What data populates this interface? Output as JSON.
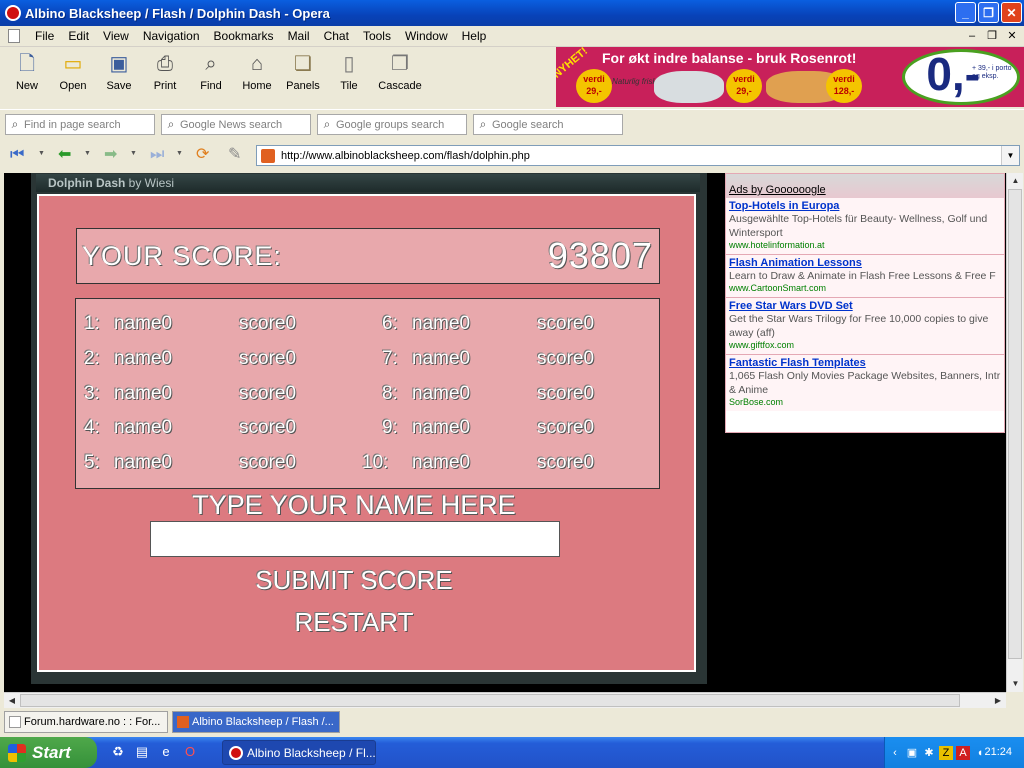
{
  "window": {
    "title": "Albino Blacksheep / Flash / Dolphin Dash - Opera",
    "minimize": "_",
    "maximize": "❐",
    "close": "✕"
  },
  "menu": {
    "items": [
      "File",
      "Edit",
      "View",
      "Navigation",
      "Bookmarks",
      "Mail",
      "Chat",
      "Tools",
      "Window",
      "Help"
    ],
    "mdi": [
      "–",
      "❐",
      "✕"
    ]
  },
  "toolbar": {
    "buttons": [
      {
        "label": "New",
        "icon": "new-page-icon"
      },
      {
        "label": "Open",
        "icon": "folder-icon"
      },
      {
        "label": "Save",
        "icon": "floppy-icon"
      },
      {
        "label": "Print",
        "icon": "printer-icon"
      },
      {
        "label": "Find",
        "icon": "magnifier-icon"
      },
      {
        "label": "Home",
        "icon": "house-icon"
      },
      {
        "label": "Panels",
        "icon": "panels-icon"
      },
      {
        "label": "Tile",
        "icon": "tile-icon"
      },
      {
        "label": "Cascade",
        "icon": "cascade-icon"
      }
    ]
  },
  "banner": {
    "headline": "For økt indre balanse - bruk Rosenrot!",
    "badge": "NYHET!",
    "pill1": "verdi 29,-",
    "tagline": "Naturlig frisk",
    "pill2": "verdi 29,-",
    "pill3": "verdi 128,-",
    "price": "0,-",
    "fineprint": "+ 39,- i porto og eksp."
  },
  "searchbar": {
    "fields": [
      {
        "placeholder": "Find in page search"
      },
      {
        "placeholder": "Google News search"
      },
      {
        "placeholder": "Google groups search"
      },
      {
        "placeholder": "Google search"
      }
    ]
  },
  "address": {
    "url": "http://www.albinoblacksheep.com/flash/dolphin.php"
  },
  "flash": {
    "header_title": "Dolphin Dash",
    "header_by": " by Wiesi",
    "score_label": "YOUR SCORE:",
    "score_value": "93807",
    "board": [
      {
        "rank": "1:",
        "name": "name0",
        "score": "score0"
      },
      {
        "rank": "2:",
        "name": "name0",
        "score": "score0"
      },
      {
        "rank": "3:",
        "name": "name0",
        "score": "score0"
      },
      {
        "rank": "4:",
        "name": "name0",
        "score": "score0"
      },
      {
        "rank": "5:",
        "name": "name0",
        "score": "score0"
      },
      {
        "rank": "6:",
        "name": "name0",
        "score": "score0"
      },
      {
        "rank": "7:",
        "name": "name0",
        "score": "score0"
      },
      {
        "rank": "8:",
        "name": "name0",
        "score": "score0"
      },
      {
        "rank": "9:",
        "name": "name0",
        "score": "score0"
      },
      {
        "rank": "10:",
        "name": "name0",
        "score": "score0"
      }
    ],
    "type_name_label": "TYPE YOUR NAME HERE",
    "name_value": "",
    "submit_label": "SUBMIT SCORE",
    "restart_label": "RESTART"
  },
  "ads": {
    "title": "Ads by Goooooogle",
    "items": [
      {
        "title": "Top-Hotels in Europa",
        "desc": "Ausgewählte Top-Hotels für Beauty- Wellness, Golf und Wintersport",
        "url": "www.hotelinformation.at"
      },
      {
        "title": "Flash Animation Lessons",
        "desc": "Learn to Draw & Animate in Flash Free Lessons & Free F",
        "url": "www.CartoonSmart.com"
      },
      {
        "title": "Free Star Wars DVD Set",
        "desc": "Get the Star Wars Trilogy for Free 10,000 copies to give away (aff)",
        "url": "www.giftfox.com"
      },
      {
        "title": "Fantastic Flash Templates",
        "desc": "1,065 Flash Only Movies Package Websites, Banners, Intr & Anime",
        "url": "SorBose.com"
      }
    ]
  },
  "pagetabs": [
    {
      "label": "Forum.hardware.no : : For...",
      "active": false
    },
    {
      "label": "Albino Blacksheep / Flash /...",
      "active": true
    }
  ],
  "taskbar": {
    "start": "Start",
    "task_label": "Albino Blacksheep / Fl...",
    "clock": "21:24"
  }
}
